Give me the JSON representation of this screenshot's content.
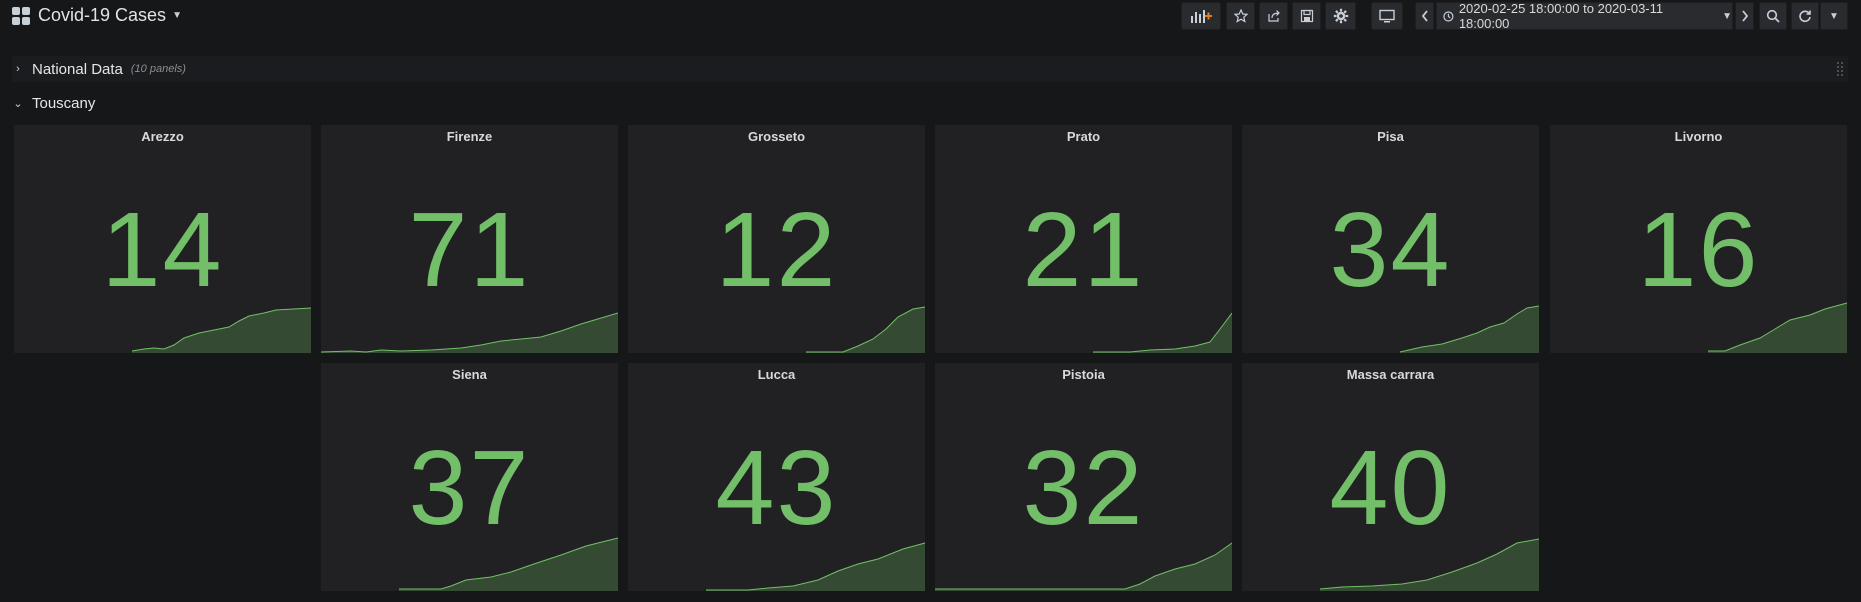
{
  "header": {
    "title": "Covid-19 Cases",
    "time_range": "2020-02-25 18:00:00 to 2020-03-11 18:00:00"
  },
  "rows": {
    "national": {
      "title": "National Data",
      "count": "(10 panels)"
    },
    "tuscany": {
      "title": "Touscany"
    }
  },
  "colors": {
    "value_green": "#73bf69",
    "panel_bg": "#212124",
    "page_bg": "#161719"
  },
  "panels": [
    {
      "title": "Arezzo",
      "value": "14"
    },
    {
      "title": "Firenze",
      "value": "71"
    },
    {
      "title": "Grosseto",
      "value": "12"
    },
    {
      "title": "Prato",
      "value": "21"
    },
    {
      "title": "Pisa",
      "value": "34"
    },
    {
      "title": "Livorno",
      "value": "16"
    },
    {
      "title": "Siena",
      "value": "37"
    },
    {
      "title": "Lucca",
      "value": "43"
    },
    {
      "title": "Pistoia",
      "value": "32"
    },
    {
      "title": "Massa carrara",
      "value": "40"
    }
  ]
}
